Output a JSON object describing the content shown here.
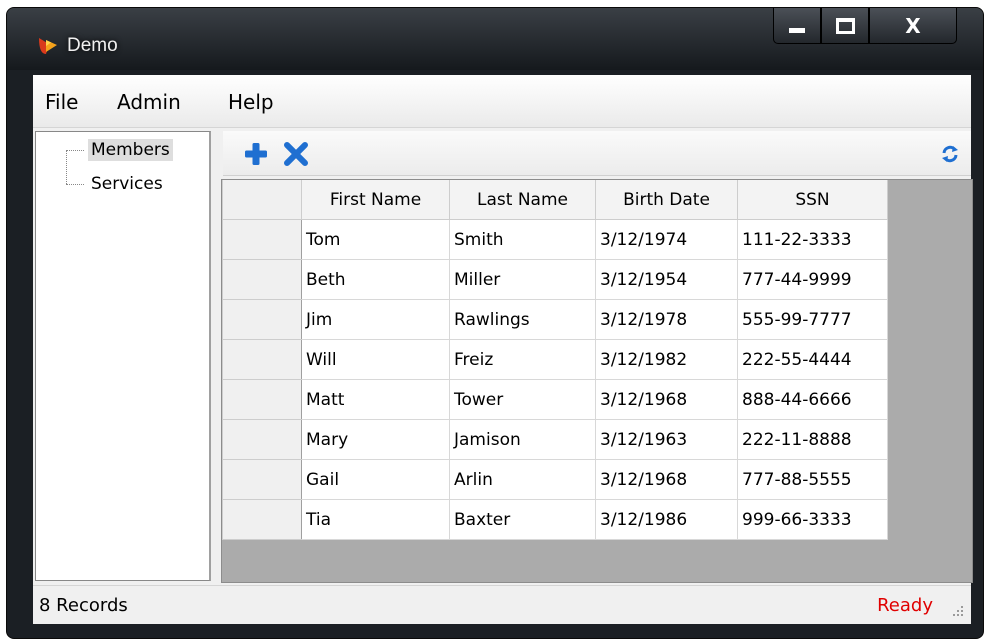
{
  "window": {
    "title": "Demo"
  },
  "menu": {
    "items": [
      "File",
      "Admin",
      "Help"
    ]
  },
  "tree": {
    "items": [
      {
        "label": "Members",
        "selected": true
      },
      {
        "label": "Services",
        "selected": false
      }
    ]
  },
  "toolbar": {
    "buttons": [
      "add-icon",
      "delete-icon",
      "refresh-icon"
    ]
  },
  "grid": {
    "columns": [
      "First Name",
      "Last Name",
      "Birth Date",
      "SSN"
    ],
    "rows": [
      [
        "Tom",
        "Smith",
        "3/12/1974",
        "111-22-3333"
      ],
      [
        "Beth",
        "Miller",
        "3/12/1954",
        "777-44-9999"
      ],
      [
        "Jim",
        "Rawlings",
        "3/12/1978",
        "555-99-7777"
      ],
      [
        "Will",
        "Freiz",
        "3/12/1982",
        "222-55-4444"
      ],
      [
        "Matt",
        "Tower",
        "3/12/1968",
        "888-44-6666"
      ],
      [
        "Mary",
        "Jamison",
        "3/12/1963",
        "222-11-8888"
      ],
      [
        "Gail",
        "Arlin",
        "3/12/1968",
        "777-88-5555"
      ],
      [
        "Tia",
        "Baxter",
        "3/12/1986",
        "999-66-3333"
      ]
    ]
  },
  "status": {
    "records": "8 Records",
    "state": "Ready"
  },
  "colors": {
    "status_ready": "#e00000",
    "icon_blue": "#1f6fd1",
    "grid_background": "#ababab"
  }
}
